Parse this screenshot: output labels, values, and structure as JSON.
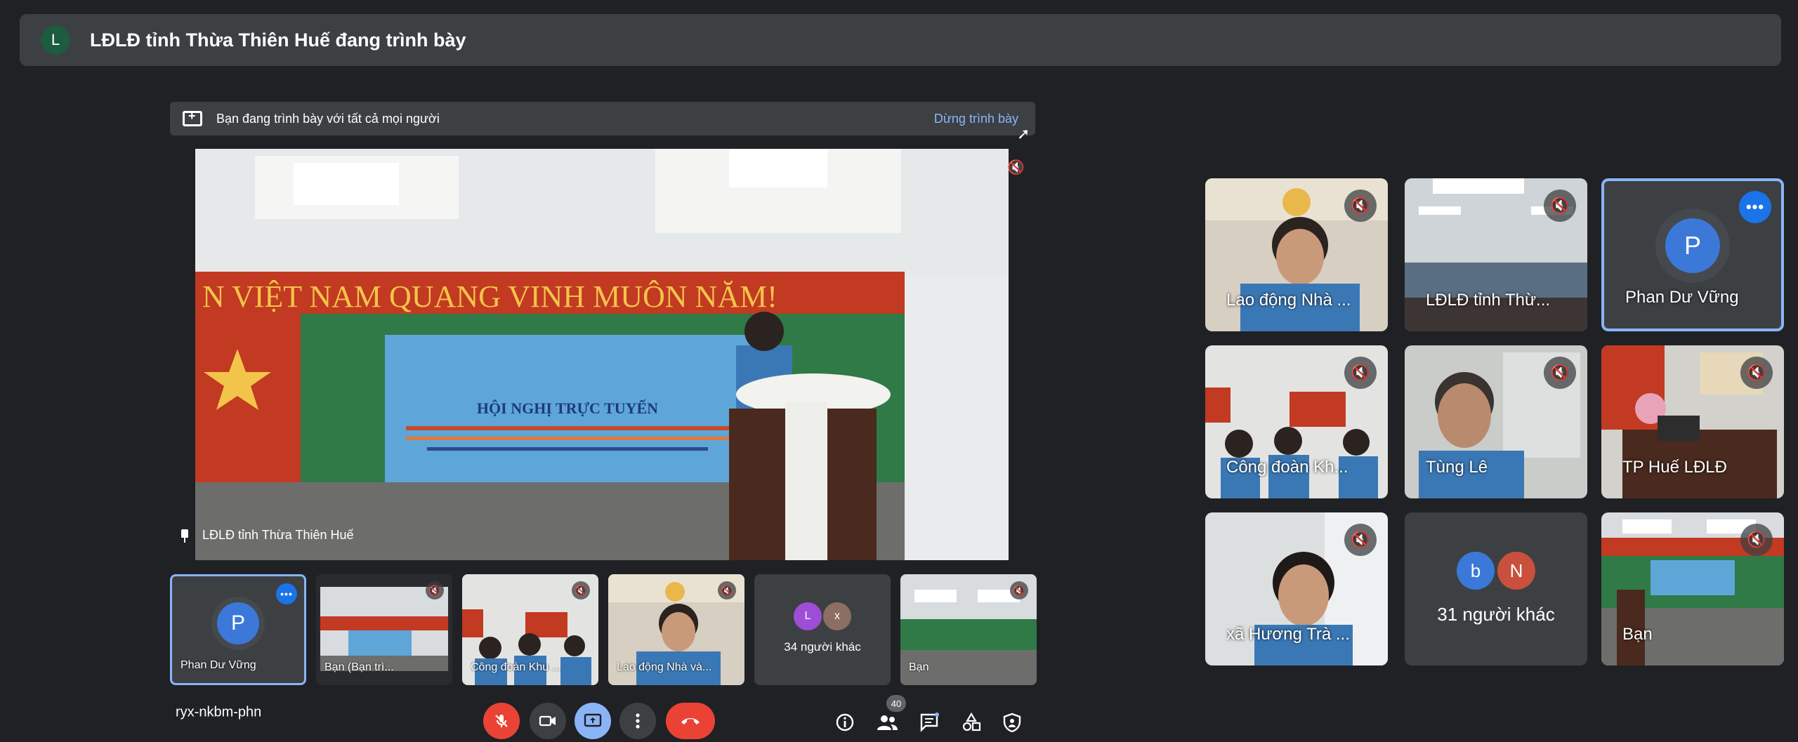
{
  "banner": {
    "avatar_letter": "L",
    "text": "LĐLĐ tỉnh Thừa Thiên Huế đang trình bày"
  },
  "presenting": {
    "label": "Bạn đang trình bày với tất cả mọi người",
    "stop_label": "Dừng trình bày"
  },
  "main_video": {
    "caption": "LĐLĐ tỉnh Thừa Thiên Huế",
    "banner_text": "N VIỆT NAM QUANG VINH MUÔN NĂM!",
    "screen_title": "HỘI NGHỊ TRỰC TUYẾN"
  },
  "filmstrip": [
    {
      "name": "Phan Dư Vững",
      "avatar": "P"
    },
    {
      "name": "Bạn (Bạn trì..."
    },
    {
      "name": "Công đoàn Khu ..."
    },
    {
      "name": "Lao động Nhà và..."
    },
    {
      "others_label": "34 người khác",
      "avatars": [
        "L",
        "x"
      ]
    },
    {
      "name": "Bạn"
    }
  ],
  "grid": [
    {
      "name": "Lao động Nhà ..."
    },
    {
      "name": "LĐLĐ tỉnh Thừ..."
    },
    {
      "name": "Phan Dư Vững",
      "avatar": "P"
    },
    {
      "name": "Công đoàn Kh..."
    },
    {
      "name": "Tùng Lê"
    },
    {
      "name": "TP Huế LĐLĐ"
    },
    {
      "name": "xã Hương Trà ..."
    },
    {
      "others_label": "31 người khác",
      "avatars": [
        "b",
        "N"
      ]
    },
    {
      "name": "Bạn"
    }
  ],
  "controls": {
    "meeting_code": "ryx-nkbm-phn",
    "participants_count": "40",
    "icons": [
      "mic-off-icon",
      "camera-icon",
      "present-icon",
      "more-icon",
      "hang-up-icon",
      "info-icon",
      "people-icon",
      "chat-icon",
      "activities-icon",
      "host-controls-icon"
    ]
  },
  "colors": {
    "background": "#202124",
    "surface": "#3c4043",
    "accent": "#8ab4f8",
    "danger": "#ea4335",
    "primary": "#1a73e8"
  }
}
